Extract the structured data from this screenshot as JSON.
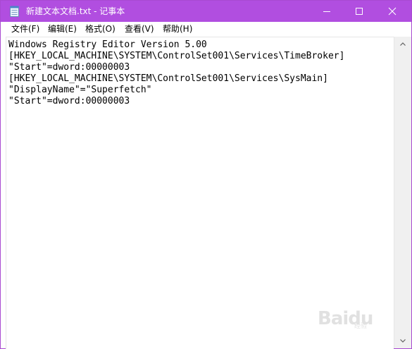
{
  "window": {
    "title": "新建文本文档.txt - 记事本",
    "app_icon": "notepad-icon",
    "caption_buttons": {
      "minimize_icon": "minimize-icon",
      "maximize_icon": "maximize-icon",
      "close_icon": "close-icon"
    },
    "titlebar_color": "#b14ee0"
  },
  "menubar": {
    "items": [
      {
        "label": "文件(F)"
      },
      {
        "label": "编辑(E)"
      },
      {
        "label": "格式(O)"
      },
      {
        "label": "查看(V)"
      },
      {
        "label": "帮助(H)"
      }
    ]
  },
  "editor": {
    "lines": [
      "Windows Registry Editor Version 5.00",
      "[HKEY_LOCAL_MACHINE\\SYSTEM\\ControlSet001\\Services\\TimeBroker]",
      "\"Start\"=dword:00000003",
      "[HKEY_LOCAL_MACHINE\\SYSTEM\\ControlSet001\\Services\\SysMain]",
      "\"DisplayName\"=\"Superfetch\"",
      "\"Start\"=dword:00000003"
    ]
  },
  "scrollbar": {
    "up_icon": "scroll-up-arrow-icon",
    "down_icon": "scroll-down-arrow-icon"
  },
  "watermark": {
    "text": "Baidu",
    "subtext": "经验"
  }
}
